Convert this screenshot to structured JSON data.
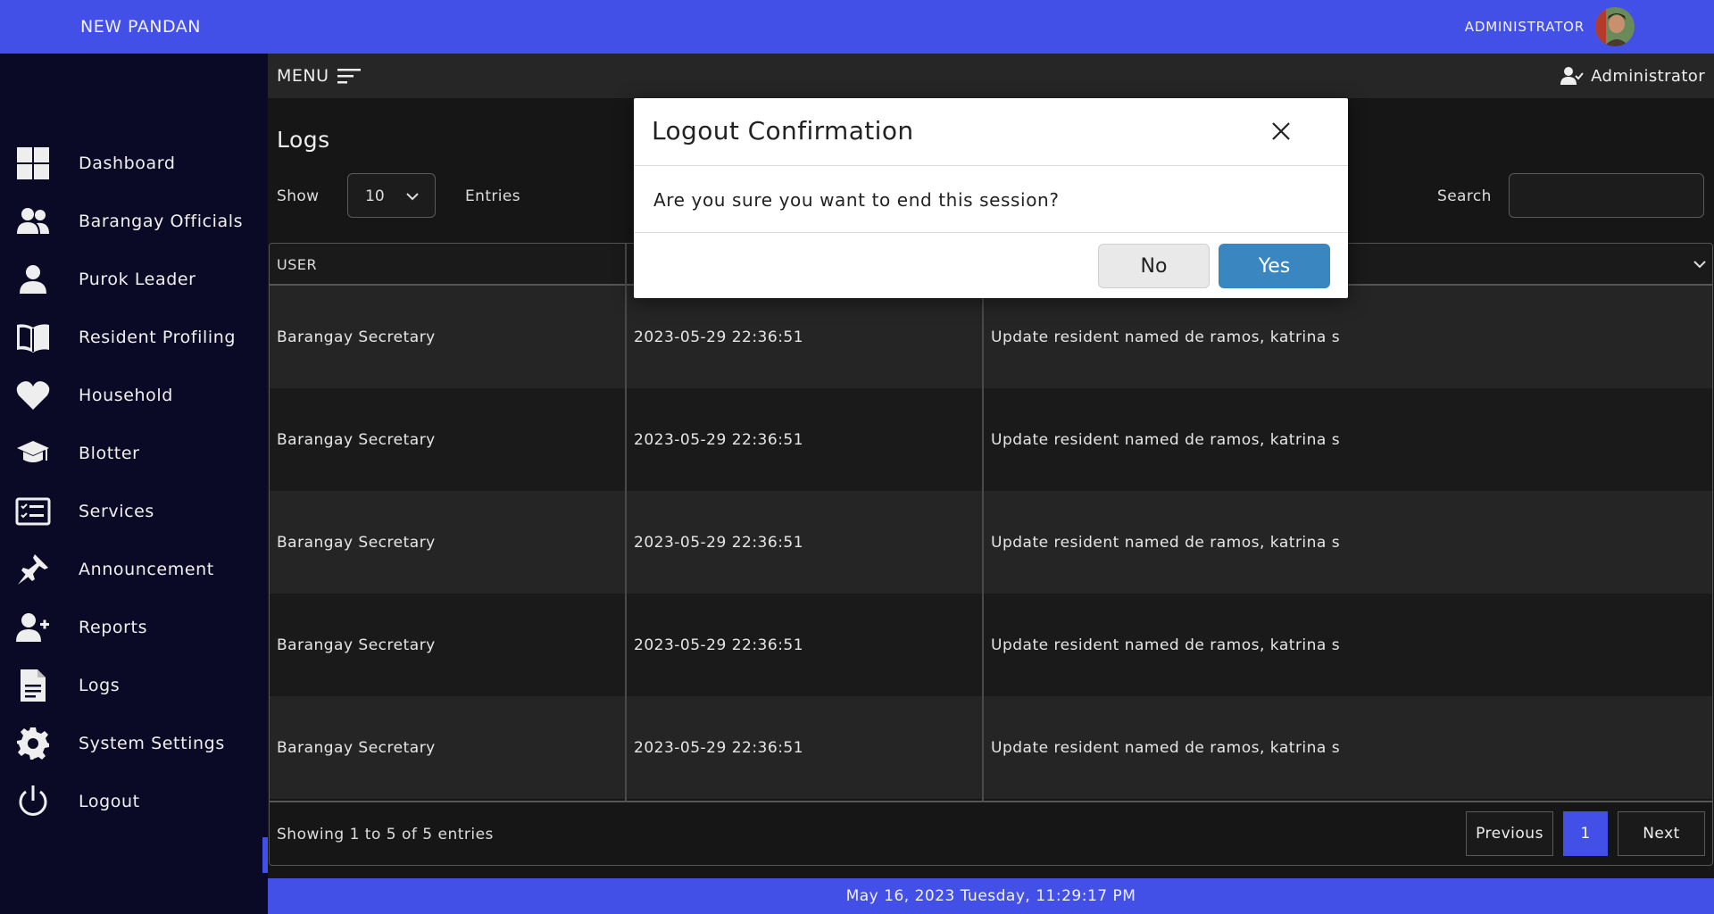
{
  "topbar": {
    "brand": "NEW PANDAN",
    "user_label": "ADMINISTRATOR"
  },
  "sidebar": {
    "items": [
      {
        "label": "Dashboard",
        "icon": "dashboard-icon"
      },
      {
        "label": "Barangay Officials",
        "icon": "users-icon"
      },
      {
        "label": "Purok Leader",
        "icon": "user-icon"
      },
      {
        "label": "Resident Profiling",
        "icon": "book-icon"
      },
      {
        "label": "Household",
        "icon": "heart-icon"
      },
      {
        "label": "Blotter",
        "icon": "graduation-cap-icon"
      },
      {
        "label": "Services",
        "icon": "checklist-icon"
      },
      {
        "label": "Announcement",
        "icon": "pin-icon"
      },
      {
        "label": "Reports",
        "icon": "user-plus-icon"
      },
      {
        "label": "Logs",
        "icon": "file-icon"
      },
      {
        "label": "System Settings",
        "icon": "gear-icon"
      },
      {
        "label": "Logout",
        "icon": "power-icon"
      }
    ]
  },
  "menubar": {
    "menu_label": "MENU",
    "user": "Administrator"
  },
  "page": {
    "title": "Logs",
    "show_label": "Show",
    "entries_value": "10",
    "entries_label": "Entries",
    "search_label": "Search",
    "search_value": ""
  },
  "table": {
    "columns": [
      "USER"
    ],
    "rows": [
      {
        "user": "Barangay Secretary",
        "date": "2023-05-29 22:36:51",
        "action": "Update resident named de ramos, katrina s"
      },
      {
        "user": "Barangay Secretary",
        "date": "2023-05-29 22:36:51",
        "action": "Update resident named de ramos, katrina s"
      },
      {
        "user": "Barangay Secretary",
        "date": "2023-05-29 22:36:51",
        "action": "Update resident named de ramos, katrina s"
      },
      {
        "user": "Barangay Secretary",
        "date": "2023-05-29 22:36:51",
        "action": "Update resident named de ramos, katrina s"
      },
      {
        "user": "Barangay Secretary",
        "date": "2023-05-29 22:36:51",
        "action": "Update resident named de ramos, katrina s"
      }
    ],
    "showing": "Showing 1 to 5 of 5 entries",
    "pagination": {
      "previous": "Previous",
      "current": "1",
      "next": "Next"
    }
  },
  "footer": {
    "datetime": "May 16, 2023 Tuesday, 11:29:17 PM"
  },
  "modal": {
    "title": "Logout Confirmation",
    "message": "Are you sure you want to end this session?",
    "no_label": "No",
    "yes_label": "Yes"
  },
  "colors": {
    "accent": "#4350e8",
    "sidebar_bg": "#0b0a26",
    "yes_button": "#3a86c0"
  }
}
